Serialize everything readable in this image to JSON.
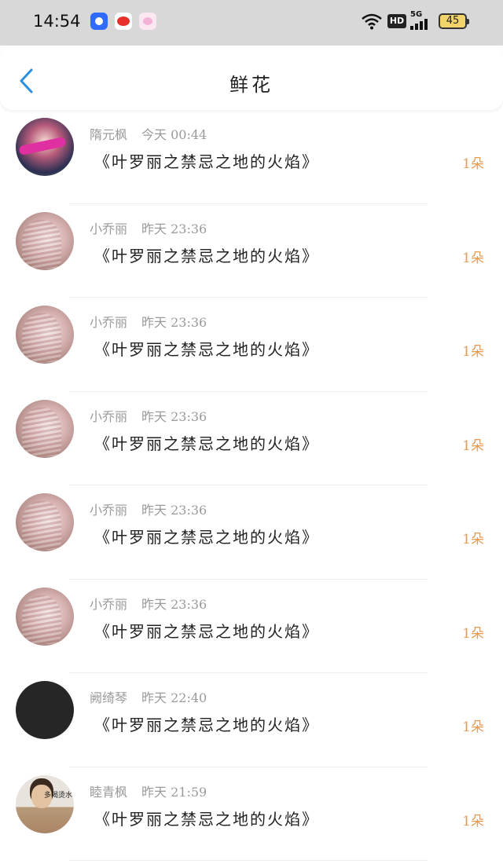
{
  "status_bar": {
    "time": "14:54",
    "network_badge": "HD",
    "network_type": "5G",
    "battery": "45"
  },
  "header": {
    "title": "鲜花"
  },
  "gifts": [
    {
      "name": "隋元枫",
      "time": "今天 00:44",
      "text": "《叶罗丽之禁忌之地的火焰》",
      "count": "1朵",
      "avatar": "warrior"
    },
    {
      "name": "小乔丽",
      "time": "昨天 23:36",
      "text": "《叶罗丽之禁忌之地的火焰》",
      "count": "1朵",
      "avatar": "girl"
    },
    {
      "name": "小乔丽",
      "time": "昨天 23:36",
      "text": "《叶罗丽之禁忌之地的火焰》",
      "count": "1朵",
      "avatar": "girl"
    },
    {
      "name": "小乔丽",
      "time": "昨天 23:36",
      "text": "《叶罗丽之禁忌之地的火焰》",
      "count": "1朵",
      "avatar": "girl"
    },
    {
      "name": "小乔丽",
      "time": "昨天 23:36",
      "text": "《叶罗丽之禁忌之地的火焰》",
      "count": "1朵",
      "avatar": "girl"
    },
    {
      "name": "小乔丽",
      "time": "昨天 23:36",
      "text": "《叶罗丽之禁忌之地的火焰》",
      "count": "1朵",
      "avatar": "girl"
    },
    {
      "name": "阙绮琴",
      "time": "昨天 22:40",
      "text": "《叶罗丽之禁忌之地的火焰》",
      "count": "1朵",
      "avatar": "black"
    },
    {
      "name": "睦青枫",
      "time": "昨天 21:59",
      "text": "《叶罗丽之禁忌之地的火焰》",
      "count": "1朵",
      "avatar": "photo",
      "avatar_caption": "多喝烫水"
    }
  ],
  "colors": {
    "accent_back": "#2d8fe0",
    "count": "#e79a52",
    "meta": "#9a9a9a",
    "status_bg": "#d8d8d8"
  }
}
